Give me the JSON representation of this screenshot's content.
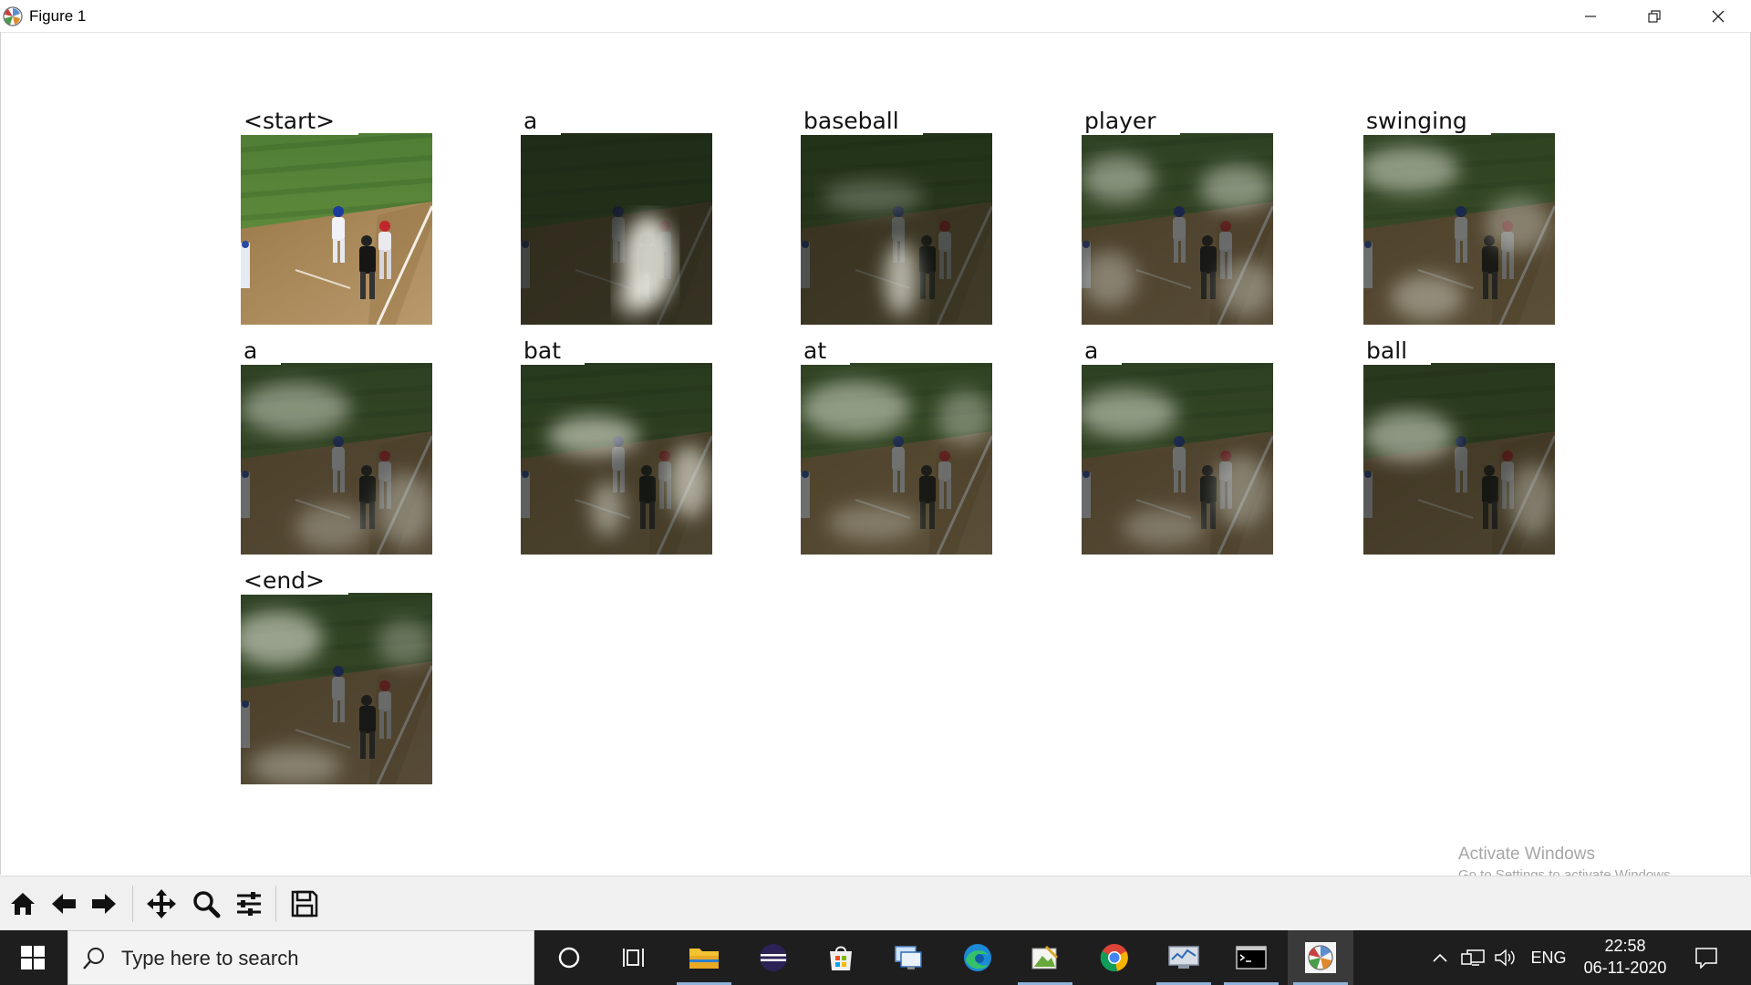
{
  "window": {
    "title": "Figure 1",
    "buttons": [
      "minimize",
      "restore",
      "close"
    ]
  },
  "figure": {
    "panels": [
      {
        "word": "<start>",
        "kind": "original"
      },
      {
        "word": "a",
        "kind": "attention"
      },
      {
        "word": "baseball",
        "kind": "attention"
      },
      {
        "word": "player",
        "kind": "attention"
      },
      {
        "word": "swinging",
        "kind": "attention"
      },
      {
        "word": "a",
        "kind": "attention"
      },
      {
        "word": "bat",
        "kind": "attention"
      },
      {
        "word": "at",
        "kind": "attention"
      },
      {
        "word": "a",
        "kind": "attention"
      },
      {
        "word": "ball",
        "kind": "attention"
      },
      {
        "word": "<end>",
        "kind": "attention"
      }
    ]
  },
  "toolbar": {
    "tools": [
      "home-icon",
      "back-arrow-icon",
      "forward-arrow-icon",
      "pan-icon",
      "zoom-icon",
      "configure-subplots-icon",
      "save-icon"
    ]
  },
  "watermark": {
    "title": "Activate Windows",
    "subtitle": "Go to Settings to activate Windows."
  },
  "taskbar": {
    "search_placeholder": "Type here to search",
    "apps": [
      "cortana-icon",
      "task-view-icon",
      "file-explorer-icon",
      "eclipse-icon",
      "store-icon",
      "remote-desktop-icon",
      "edge-icon",
      "paint-icon",
      "chrome-icon",
      "resource-monitor-icon",
      "terminal-icon",
      "matplotlib-icon"
    ],
    "language": "ENG",
    "time": "22:58",
    "date": "06-11-2020"
  },
  "colors": {
    "taskbar": "#1e1e1e",
    "toolbar": "#f0f0f0",
    "field_green": "#4e7d3a",
    "dirt": "#a8875c"
  }
}
